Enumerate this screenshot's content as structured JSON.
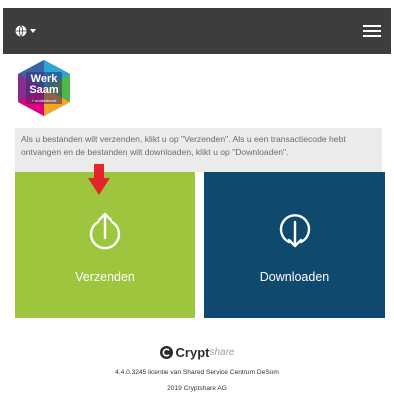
{
  "header": {
    "language_icon": "globe-icon",
    "menu_icon": "hamburger-menu-icon"
  },
  "logo": {
    "line1": "Werk",
    "line2": "Saam",
    "line3": "+ ondersteunt"
  },
  "info": {
    "text": "Als u bestanden wilt verzenden, klikt u op \"Verzenden\". Als u een transactiecode hebt ontvangen en de bestanden wilt downloaden, klikt u op \"Downloaden\"."
  },
  "tiles": {
    "send": {
      "label": "Verzenden",
      "icon": "upload-icon",
      "color": "#9dc53d"
    },
    "download": {
      "label": "Downloaden",
      "icon": "download-icon",
      "color": "#0f4a6e"
    }
  },
  "annotation": {
    "icon": "red-arrow-down-icon",
    "color": "#e3262b"
  },
  "footer": {
    "brand_bold": "Crypt",
    "brand_italic": "share",
    "license": "4.4.0.3245 licentie van Shared Service Centrum DeSom",
    "copyright": "2019 Cryptshare AG"
  }
}
